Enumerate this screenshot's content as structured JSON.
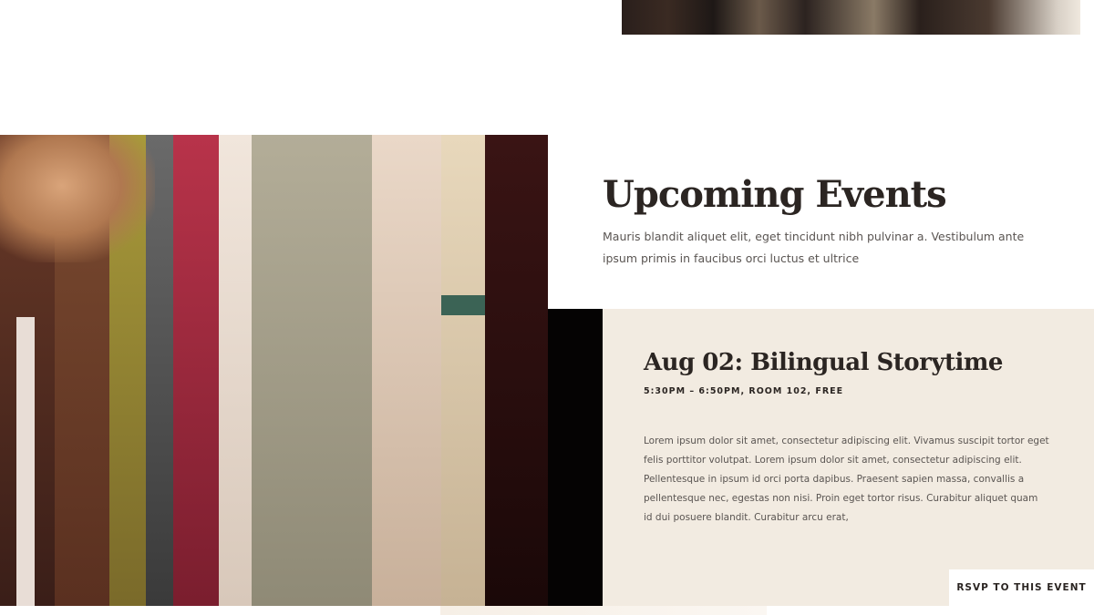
{
  "events": {
    "heading": "Upcoming Events",
    "intro": "Mauris blandit aliquet elit, eget tincidunt nibh pulvinar a. Vestibulum ante ipsum primis in faucibus orci luctus et ultrice"
  },
  "event": {
    "title": "Aug 02: Bilingual Storytime",
    "meta": "5:30PM – 6:50PM, ROOM 102, FREE",
    "description": "Lorem ipsum dolor sit amet, consectetur adipiscing elit. Vivamus suscipit tortor eget felis porttitor volutpat. Lorem ipsum dolor sit amet, consectetur adipiscing elit. Pellentesque in ipsum id orci porta dapibus. Praesent sapien massa, convallis a pellentesque nec, egestas non nisi. Proin eget tortor risus. Curabitur aliquet quam id dui posuere blandit. Curabitur arcu erat,",
    "rsvp_label": "RSVP TO THIS EVENT"
  },
  "colors": {
    "heading": "#2b2522",
    "body_text": "#5a5552",
    "card_background": "#f2ebe1",
    "dark_block": "#050303"
  }
}
